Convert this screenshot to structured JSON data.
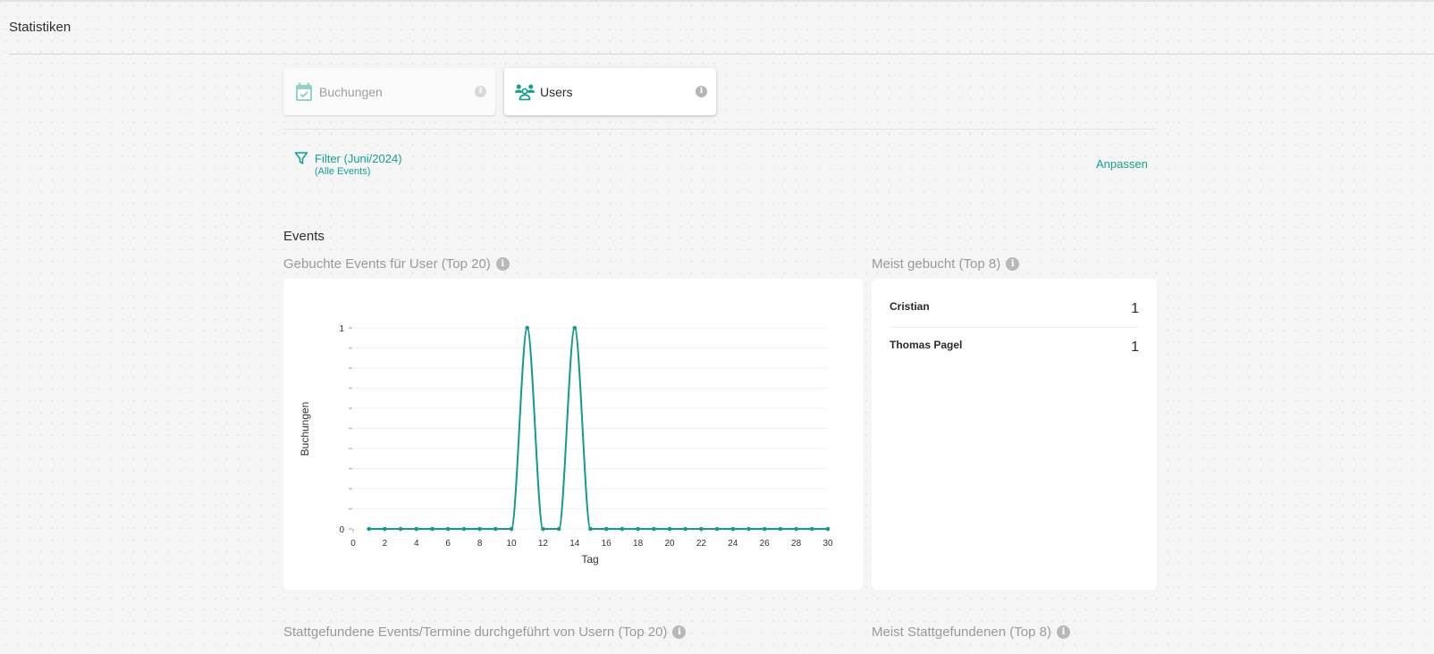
{
  "page": {
    "title": "Statistiken"
  },
  "tabs": [
    {
      "label": "Buchungen",
      "icon": "calendar-check-icon",
      "active": false
    },
    {
      "label": "Users",
      "icon": "users-group-icon",
      "active": true
    }
  ],
  "filter": {
    "title": "Filter (Juni/2024)",
    "subtitle": "(Alle Events)",
    "adjust_label": "Anpassen"
  },
  "colors": {
    "accent": "#14a090",
    "line": "#139b8b"
  },
  "sections": {
    "events_heading": "Events",
    "booked_chart_title": "Gebuchte Events für User (Top 20)",
    "most_booked_title": "Meist gebucht (Top 8)",
    "held_chart_title": "Stattgefundene Events/Termine durchgeführt von Usern (Top 20)",
    "most_held_title": "Meist Stattgefundenen (Top 8)"
  },
  "most_booked": [
    {
      "name": "Cristian",
      "count": "1"
    },
    {
      "name": "Thomas Pagel",
      "count": "1"
    }
  ],
  "chart_data": {
    "type": "line",
    "title": "Gebuchte Events für User (Top 20)",
    "xlabel": "Tag",
    "ylabel": "Buchungen",
    "x": [
      1,
      2,
      3,
      4,
      5,
      6,
      7,
      8,
      9,
      10,
      11,
      12,
      13,
      14,
      15,
      16,
      17,
      18,
      19,
      20,
      21,
      22,
      23,
      24,
      25,
      26,
      27,
      28,
      29,
      30
    ],
    "series": [
      {
        "name": "Buchungen",
        "values": [
          0,
          0,
          0,
          0,
          0,
          0,
          0,
          0,
          0,
          0,
          1,
          0,
          0,
          1,
          0,
          0,
          0,
          0,
          0,
          0,
          0,
          0,
          0,
          0,
          0,
          0,
          0,
          0,
          0,
          0
        ]
      }
    ],
    "xlim": [
      0,
      30
    ],
    "ylim": [
      0,
      1
    ],
    "x_ticks": [
      "0",
      "2",
      "4",
      "6",
      "8",
      "10",
      "12",
      "14",
      "16",
      "18",
      "20",
      "22",
      "24",
      "26",
      "28",
      "30"
    ],
    "y_ticks": [
      "0",
      "1"
    ],
    "y_minor_divisions": 10,
    "grid": true,
    "legend": "none"
  }
}
